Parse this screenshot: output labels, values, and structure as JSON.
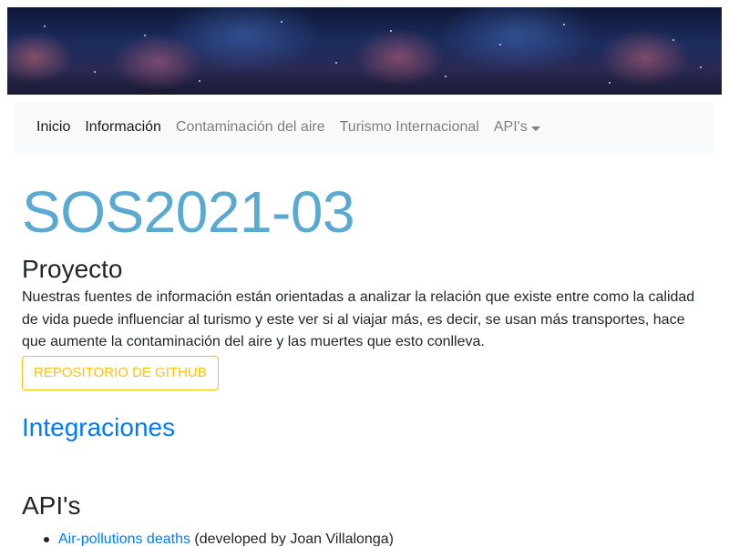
{
  "navbar": {
    "items": [
      {
        "label": "Inicio",
        "active": true
      },
      {
        "label": "Información",
        "active": true
      },
      {
        "label": "Contaminación del aire",
        "active": false
      },
      {
        "label": "Turismo Internacional",
        "active": false
      },
      {
        "label": "API's",
        "active": false,
        "dropdown": true
      }
    ]
  },
  "main": {
    "title": "SOS2021-03",
    "project_heading": "Proyecto",
    "description": "Nuestras fuentes de información están orientadas a analizar la relación que existe entre como la calidad de vida puede influenciar al turismo y este ver si al viajar más, es decir, se usan más transportes, hace que aumente la contaminación del aire y las muertes que esto conlleva.",
    "github_button": "REPOSITORIO DE GITHUB",
    "integrations_heading": "Integraciones",
    "apis_heading": "API's",
    "apis": [
      {
        "link": "Air-pollutions deaths",
        "suffix": " (developed by Joan Villalonga)"
      }
    ]
  },
  "colors": {
    "title": "#5aa9d1",
    "link": "#007bff",
    "warning": "#ffc107",
    "navbar_bg": "#f8f9fa"
  }
}
